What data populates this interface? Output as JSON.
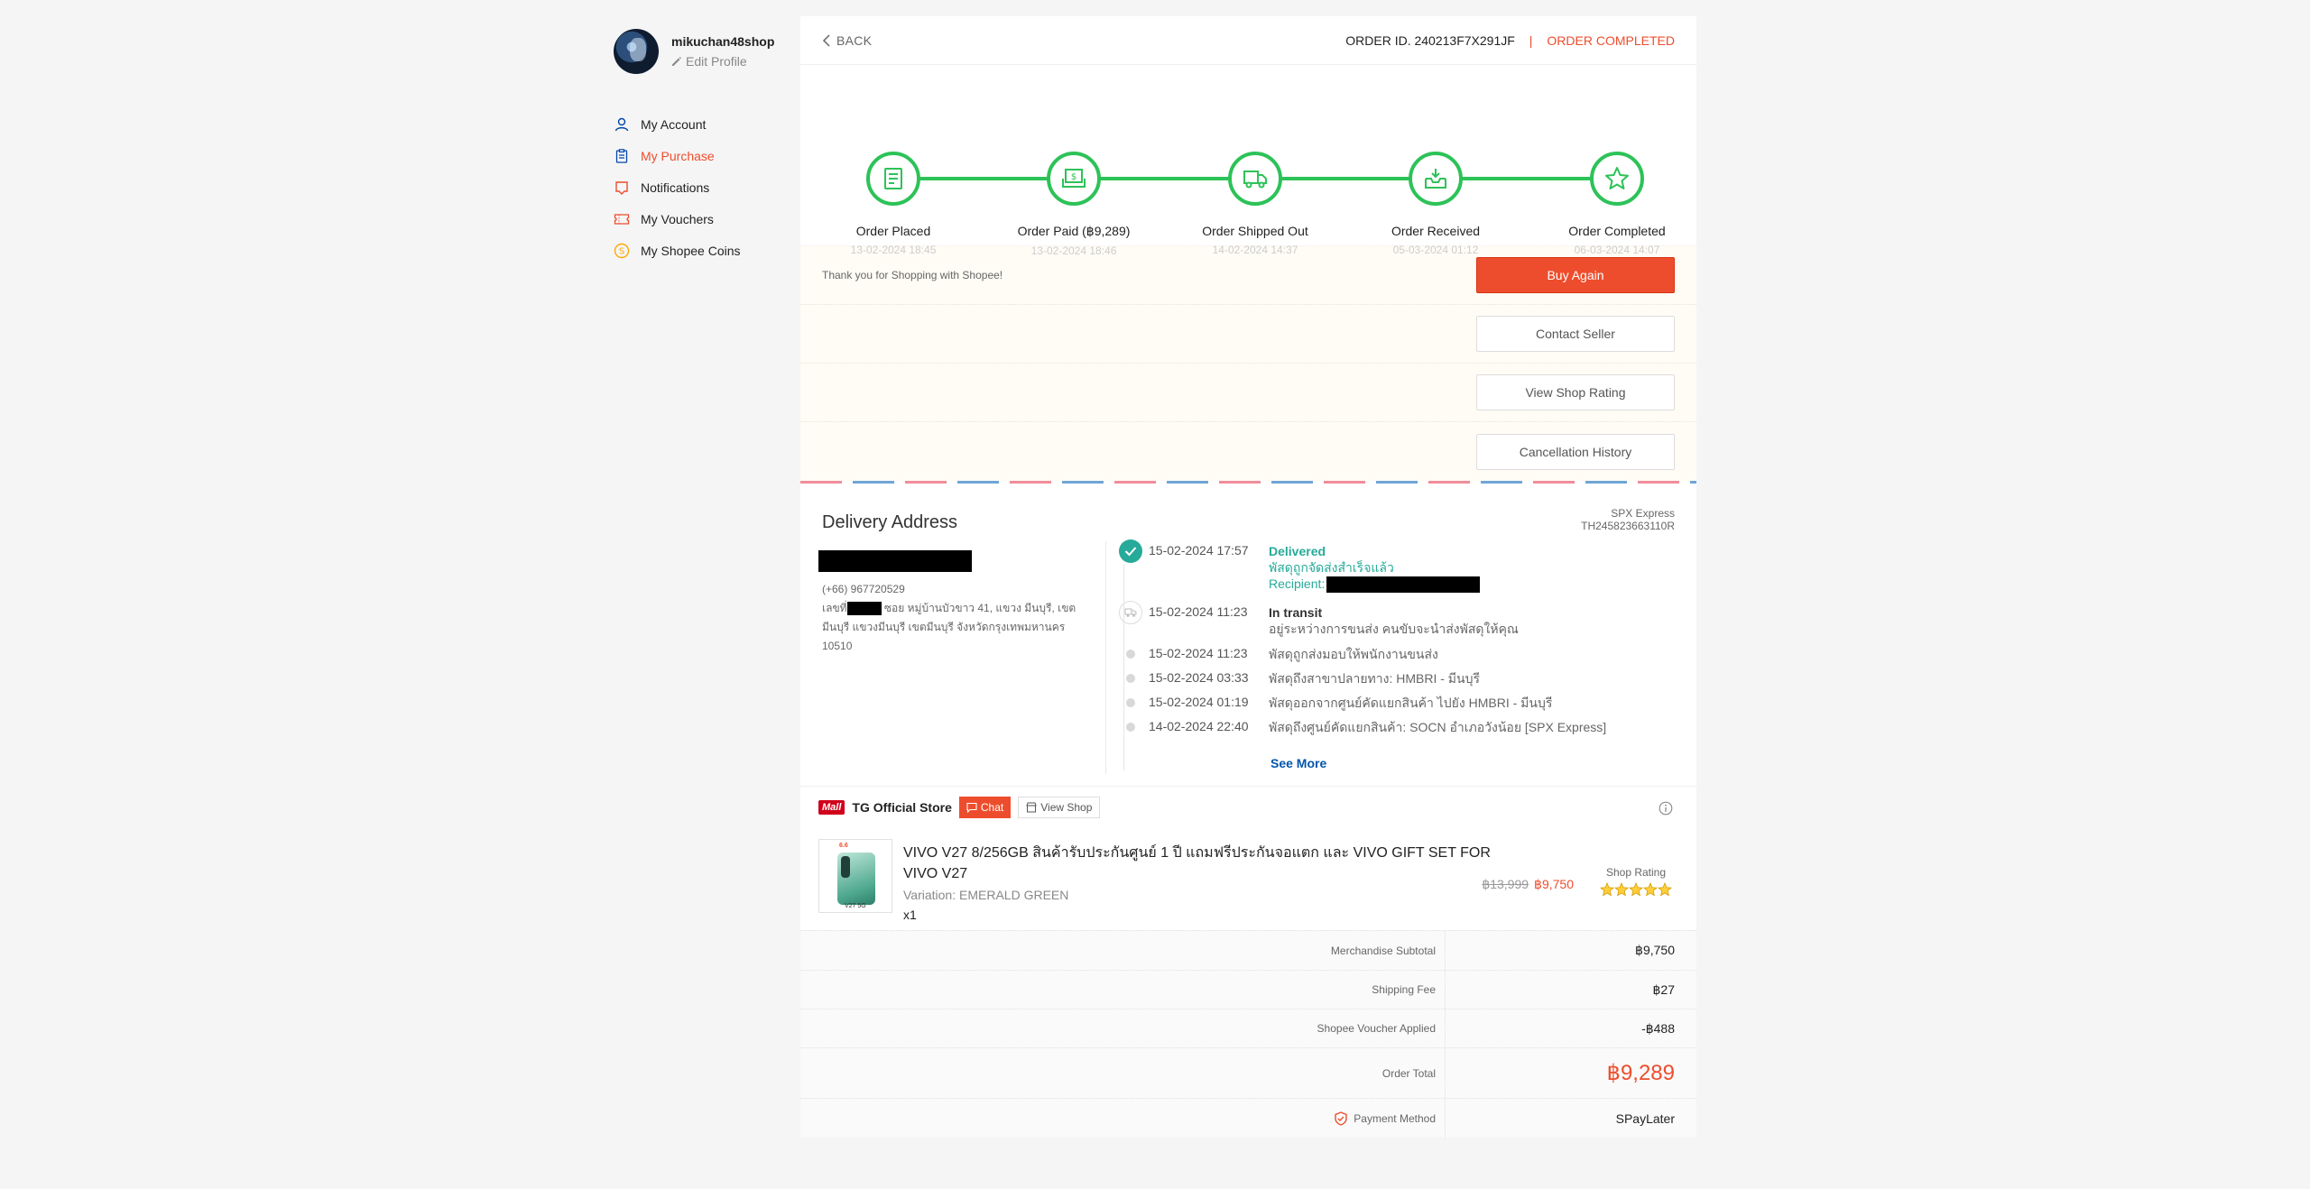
{
  "profile": {
    "username": "mikuchan48shop",
    "edit_label": "Edit Profile"
  },
  "sidebar": {
    "items": [
      {
        "label": "My Account",
        "icon": "user-icon",
        "active": false
      },
      {
        "label": "My Purchase",
        "icon": "clipboard-icon",
        "active": true
      },
      {
        "label": "Notifications",
        "icon": "bell-icon",
        "active": false
      },
      {
        "label": "My Vouchers",
        "icon": "voucher-icon",
        "active": false
      },
      {
        "label": "My Shopee Coins",
        "icon": "coin-icon",
        "active": false
      }
    ]
  },
  "header": {
    "back_label": "BACK",
    "order_id": "ORDER ID. 240213F7X291JF",
    "separator": "|",
    "status": "ORDER COMPLETED"
  },
  "steps": [
    {
      "title": "Order Placed",
      "time": "13-02-2024 18:45",
      "icon": "receipt-icon"
    },
    {
      "title": "Order Paid (฿9,289)",
      "time": "13-02-2024 18:46",
      "icon": "money-icon"
    },
    {
      "title": "Order Shipped Out",
      "time": "14-02-2024 14:37",
      "icon": "truck-icon"
    },
    {
      "title": "Order Received",
      "time": "05-03-2024 01:12",
      "icon": "inbox-icon"
    },
    {
      "title": "Order Completed",
      "time": "06-03-2024 14:07",
      "icon": "star-icon"
    }
  ],
  "actions": {
    "thanks": "Thank you for Shopping with Shopee!",
    "buy_again": "Buy Again",
    "contact_seller": "Contact Seller",
    "view_shop_rating": "View Shop Rating",
    "cancellation_history": "Cancellation History"
  },
  "delivery": {
    "title": "Delivery Address",
    "carrier": "SPX Express",
    "tracking": "TH245823663110R",
    "phone": "(+66) 967720529",
    "address_prefix": "เลขที่",
    "address_rest": " ซอย หมู่บ้านบัวขาว 41, แขวง มีนบุรี, เขต มีนบุรี แขวงมีนบุรี เขตมีนบุรี จังหวัดกรุงเทพมหานคร 10510",
    "see_more": "See More",
    "events": [
      {
        "time": "15-02-2024 17:57",
        "status": "Delivered",
        "text": "พัสดุถูกจัดส่งสำเร็จแล้ว",
        "recipient_label": "Recipient:"
      },
      {
        "time": "15-02-2024 11:23",
        "status": "In transit",
        "text": "อยู่ระหว่างการขนส่ง คนขับจะนำส่งพัสดุให้คุณ"
      },
      {
        "time": "15-02-2024 11:23",
        "text": "พัสดุถูกส่งมอบให้พนักงานขนส่ง"
      },
      {
        "time": "15-02-2024 03:33",
        "text": "พัสดุถึงสาขาปลายทาง: HMBRI - มีนบุรี"
      },
      {
        "time": "15-02-2024 01:19",
        "text": "พัสดุออกจากศูนย์คัดแยกสินค้า ไปยัง HMBRI - มีนบุรี"
      },
      {
        "time": "14-02-2024 22:40",
        "text": "พัสดุถึงศูนย์คัดแยกสินค้า: SOCN อำเภอวังน้อย [SPX Express]"
      }
    ]
  },
  "shop": {
    "mall_badge": "Mall",
    "name": "TG Official Store",
    "chat_label": "Chat",
    "view_shop_label": "View Shop"
  },
  "product": {
    "title": "VIVO V27 8/256GB สินค้ารับประกันศูนย์ 1 ปี แถมฟรีประกันจอแตก และ VIVO GIFT SET FOR VIVO V27",
    "variation": "Variation: EMERALD GREEN",
    "qty": "x1",
    "old_price": "฿13,999",
    "price": "฿9,750",
    "rating_label": "Shop Rating",
    "rating_stars": 5,
    "thumb_tag": "6.6",
    "thumb_label": "V27 5G"
  },
  "summary": [
    {
      "label": "Merchandise Subtotal",
      "value": "฿9,750"
    },
    {
      "label": "Shipping Fee",
      "value": "฿27"
    },
    {
      "label": "Shopee Voucher Applied",
      "value": "-฿488"
    },
    {
      "label": "Order Total",
      "value": "฿9,289"
    },
    {
      "label": "Payment Method",
      "value": "SPayLater"
    }
  ],
  "colors": {
    "accent": "#ee4d2d",
    "success": "#2dc258",
    "teal": "#26aa99",
    "link": "#0055aa"
  }
}
